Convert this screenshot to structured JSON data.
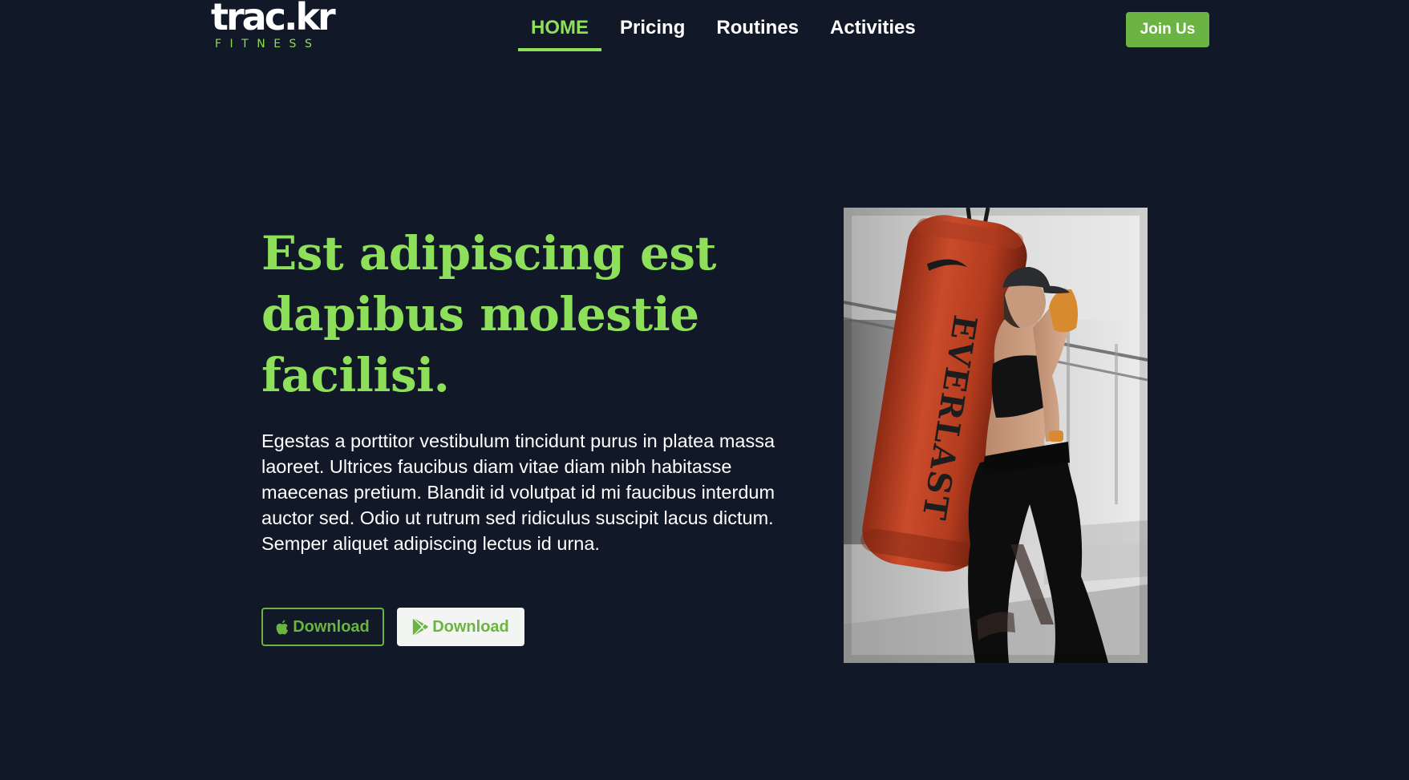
{
  "brand": {
    "name": "trac.kr",
    "tagline": "FITNESS"
  },
  "nav": {
    "items": [
      {
        "label": "HOME",
        "active": true
      },
      {
        "label": "Pricing",
        "active": false
      },
      {
        "label": "Routines",
        "active": false
      },
      {
        "label": "Activities",
        "active": false
      }
    ],
    "join_label": "Join Us"
  },
  "hero": {
    "title": "Est adipiscing est dapibus molestie facilisi.",
    "body": "Egestas a porttitor vestibulum tincidunt purus in platea massa laoreet. Ultrices faucibus diam vitae diam nibh habitasse maecenas pretium. Blandit id volutpat id mi faucibus interdum auctor sed. Odio ut rutrum sed ridiculus suscipit lacus dictum. Semper aliquet adipiscing lectus id urna.",
    "buttons": [
      {
        "label": "Download",
        "icon": "apple-icon"
      },
      {
        "label": "Download",
        "icon": "google-play-icon"
      }
    ],
    "photo": {
      "bag_text": "EVERLAST"
    }
  },
  "colors": {
    "background": "#111827",
    "accent": "#8ee05a",
    "button_green": "#6bb443",
    "text": "#ffffff"
  }
}
